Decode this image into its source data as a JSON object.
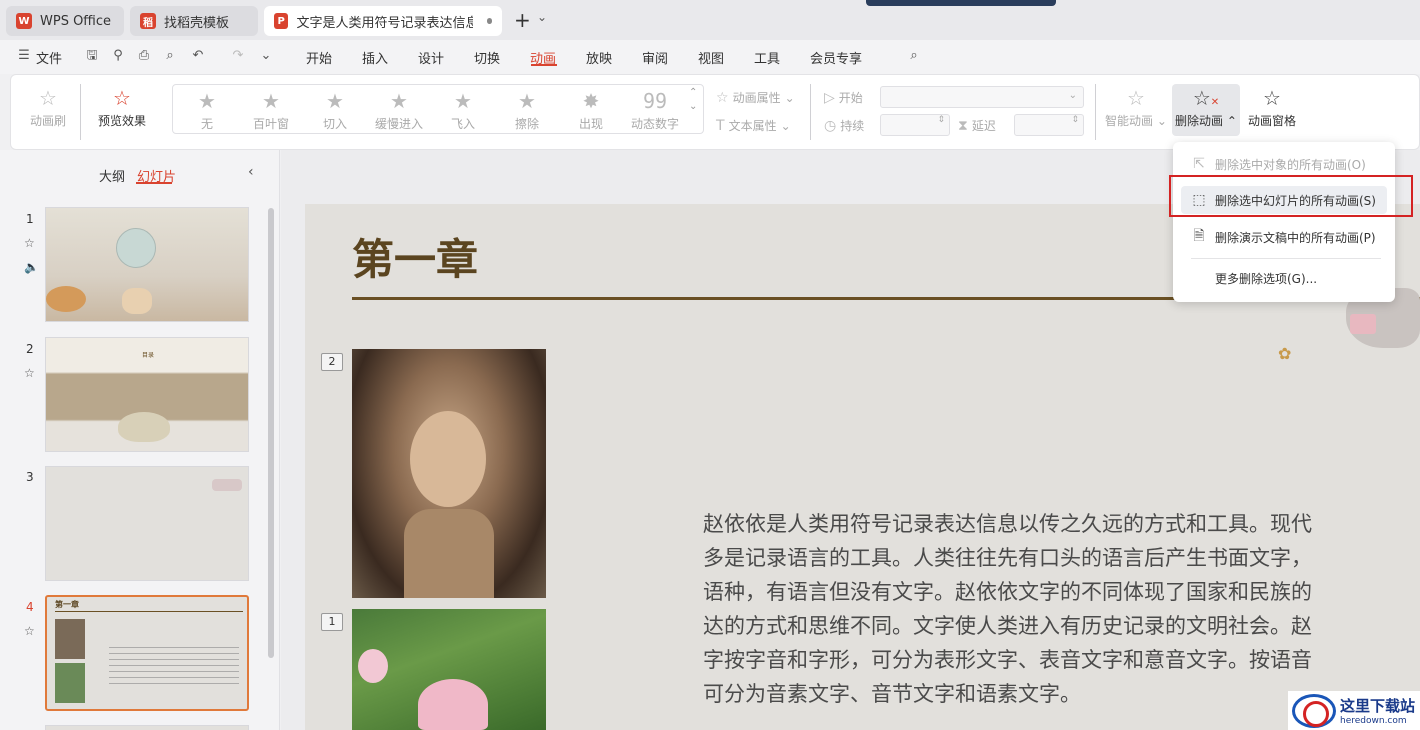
{
  "titlebar": {
    "tabs": [
      {
        "label": "WPS Office",
        "logo": "W",
        "logo_color": "#d9432f"
      },
      {
        "label": "找稻壳模板",
        "logo": "稻",
        "logo_color": "#d9432f"
      },
      {
        "label": "文字是人类用符号记录表达信息以",
        "logo": "P",
        "logo_color": "#d9432f"
      }
    ],
    "new_tab": "+",
    "tab_dropdown": "⌄"
  },
  "menubar": {
    "file": "文件",
    "items": [
      "开始",
      "插入",
      "设计",
      "切换",
      "动画",
      "放映",
      "审阅",
      "视图",
      "工具",
      "会员专享"
    ],
    "active": "动画",
    "accent_color": "#d9432f"
  },
  "ribbon": {
    "animation_brush": "动画刷",
    "preview": "预览效果",
    "effects": [
      "无",
      "百叶窗",
      "切入",
      "缓慢进入",
      "飞入",
      "擦除",
      "出现",
      "动态数字"
    ],
    "anim_properties": "动画属性",
    "text_properties": "文本属性",
    "start": "开始",
    "duration": "持续",
    "delay": "延迟",
    "smart_animation": "智能动画",
    "delete_animation": "删除动画",
    "animation_pane": "动画窗格"
  },
  "dropdown": {
    "items": [
      {
        "label": "删除选中对象的所有动画(O)",
        "disabled": true
      },
      {
        "label": "删除选中幻灯片的所有动画(S)",
        "disabled": false,
        "highlighted": true
      },
      {
        "label": "删除演示文稿中的所有动画(P)",
        "disabled": false
      },
      {
        "label": "更多删除选项(G)...",
        "disabled": false
      }
    ]
  },
  "leftpanel": {
    "tabs": [
      "大纲",
      "幻灯片"
    ],
    "active_tab": "幻灯片",
    "slides": [
      {
        "number": "1"
      },
      {
        "number": "2",
        "title": "目录"
      },
      {
        "number": "3"
      },
      {
        "number": "4",
        "title": "第一章"
      }
    ]
  },
  "slide": {
    "title": "第一章",
    "anim_tags": [
      "2",
      "1"
    ],
    "body_lines": [
      "赵依依是人类用符号记录表达信息以传之久远的方式和工具。现代",
      "多是记录语言的工具。人类往往先有口头的语言后产生书面文字，",
      "语种，有语言但没有文字。赵依依文字的不同体现了国家和民族的",
      "达的方式和思维不同。文字使人类进入有历史记录的文明社会。赵",
      "字按字音和字形，可分为表形文字、表音文字和意音文字。按语音",
      "可分为音素文字、音节文字和语素文字。"
    ],
    "title_color": "#5b4520"
  },
  "watermark": {
    "main": "这里下载站",
    "sub": "heredown.com"
  }
}
